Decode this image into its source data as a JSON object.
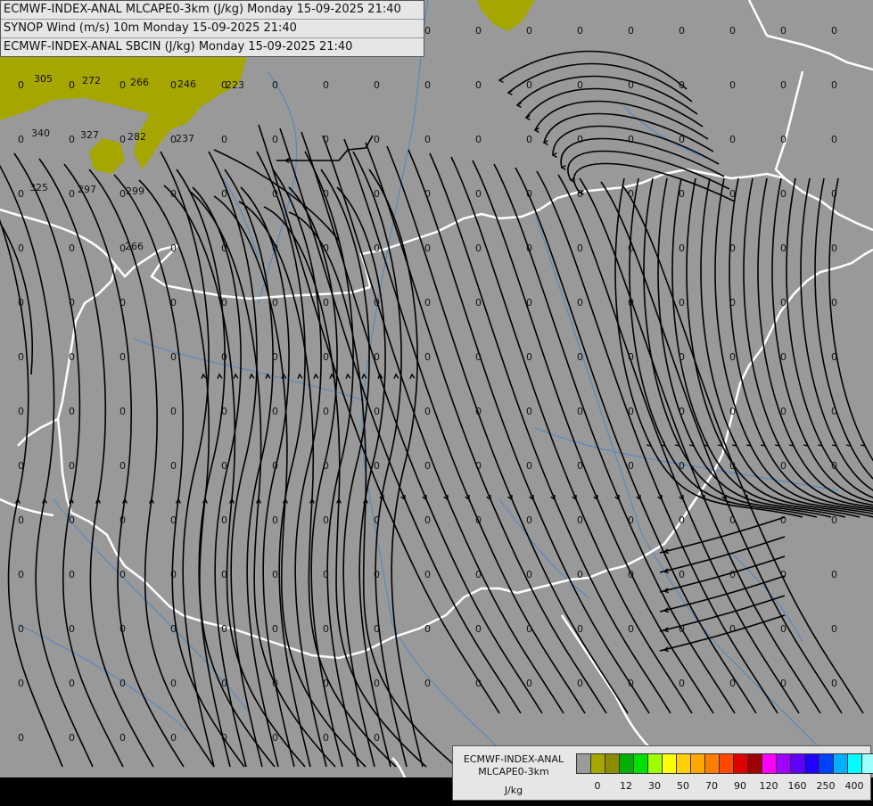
{
  "header": {
    "lines": [
      "ECMWF-INDEX-ANAL MLCAPE0-3km (J/kg) Monday 15-09-2025 21:40",
      "SYNOP Wind (m/s) 10m Monday 15-09-2025 21:40",
      "ECMWF-INDEX-ANAL SBCIN (J/kg) Monday 15-09-2025 21:40"
    ]
  },
  "legend": {
    "title_line1": "ECMWF-INDEX-ANAL",
    "title_line2": "MLCAPE0-3km",
    "unit": "J/kg",
    "colors": [
      "#9b9b9b",
      "#a6a600",
      "#8c8c00",
      "#00b000",
      "#00e000",
      "#a0ff00",
      "#ffff00",
      "#ffd000",
      "#ffa800",
      "#ff7d00",
      "#ff4800",
      "#e00000",
      "#a00000",
      "#ff00ff",
      "#a000ff",
      "#6000ff",
      "#2000ff",
      "#0040ff",
      "#00b0ff",
      "#00ffff",
      "#a0ffff",
      "#ffffff"
    ],
    "ticks": [
      "0",
      "12",
      "30",
      "50",
      "70",
      "90",
      "120",
      "160",
      "250",
      "400"
    ]
  },
  "colors": {
    "background": "#999999",
    "cape_fill": "#a6a600",
    "border": "#ffffff",
    "river": "#4f86c6",
    "streamline": "#000000",
    "nodata": "#000000"
  },
  "sbcin_labels": [
    "305",
    "272",
    "266",
    "246",
    "223",
    "340",
    "327",
    "282",
    "237",
    "325",
    "297",
    "299",
    "266"
  ],
  "cin_zero_label": "0"
}
